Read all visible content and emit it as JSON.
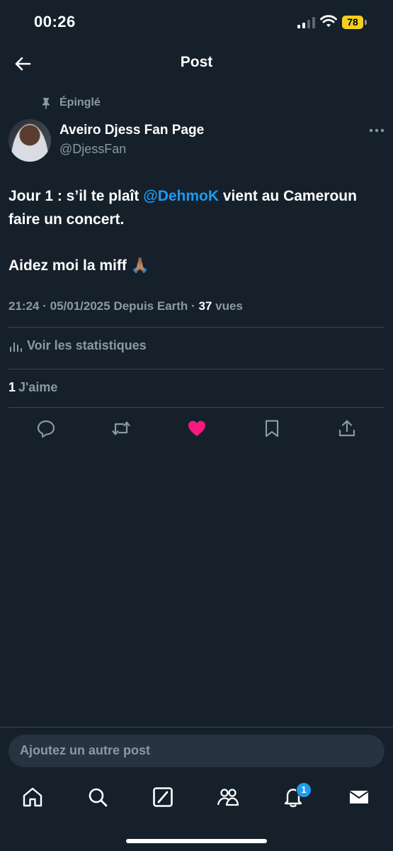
{
  "status_bar": {
    "time": "00:26",
    "battery_level": "78",
    "battery_color": "#f5d020",
    "icons": [
      "signal-icon",
      "wifi-icon",
      "battery-icon"
    ]
  },
  "header": {
    "title": "Post",
    "back_icon": "arrow-left-icon"
  },
  "post": {
    "pinned_label": "Épinglé",
    "author": {
      "name": "Aveiro Djess Fan Page",
      "handle": "@DjessFan"
    },
    "text": {
      "line1_before": "Jour 1 : s’il te plaît ",
      "mention": "@DehmoK",
      "line1_after": " vient au Cameroun faire un concert.",
      "line2": "Aidez moi la miff 🙏🏽"
    },
    "meta": {
      "time": "21:24",
      "date": "05/01/2025",
      "source": "Depuis Earth",
      "views_count": "37",
      "views_label": "vues",
      "separator": "·"
    },
    "stats_label": "Voir les statistiques",
    "likes": {
      "count": "1",
      "label": "J'aime"
    },
    "actions": [
      "reply-icon",
      "repost-icon",
      "like-icon",
      "bookmark-icon",
      "share-icon"
    ],
    "like_color": "#f91880"
  },
  "reply": {
    "placeholder": "Ajoutez un autre post"
  },
  "tabbar": {
    "items": [
      "home-icon",
      "search-icon",
      "grok-icon",
      "communities-icon",
      "notifications-icon",
      "messages-icon"
    ],
    "notifications_badge": "1"
  },
  "colors": {
    "background": "#15202b",
    "accent": "#1d9bf0",
    "secondary_text": "#8b98a5",
    "divider": "#38444d"
  }
}
